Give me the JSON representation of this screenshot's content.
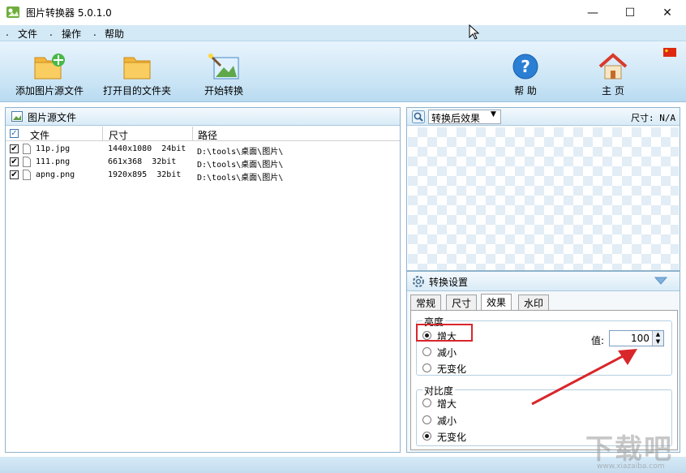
{
  "window": {
    "title": "图片转换器 5.0.1.0"
  },
  "menu": {
    "items": [
      "文件",
      "操作",
      "帮助"
    ]
  },
  "toolbar": {
    "add_source": "添加图片源文件",
    "open_dest": "打开目的文件夹",
    "start": "开始转换",
    "help": "帮 助",
    "home": "主 页"
  },
  "source_panel": {
    "title": "图片源文件",
    "columns": [
      "文件",
      "尺寸",
      "路径"
    ],
    "rows": [
      {
        "checked": true,
        "name": "11p.jpg",
        "size": "1440x1080  24bit",
        "path": "D:\\tools\\桌面\\图片\\"
      },
      {
        "checked": true,
        "name": "111.png",
        "size": "661x368  32bit",
        "path": "D:\\tools\\桌面\\图片\\"
      },
      {
        "checked": true,
        "name": "apng.png",
        "size": "1920x895  32bit",
        "path": "D:\\tools\\桌面\\图片\\"
      }
    ]
  },
  "preview": {
    "mode": "转换后效果",
    "size_label": "尺寸: N/A"
  },
  "settings": {
    "title": "转换设置",
    "tabs": [
      "常规",
      "尺寸",
      "效果",
      "水印"
    ],
    "active_tab": "效果",
    "brightness": {
      "label": "亮度",
      "options": [
        "增大",
        "减小",
        "无变化"
      ],
      "selected": "增大",
      "value_label": "值:",
      "value": "100"
    },
    "contrast": {
      "label": "对比度",
      "options": [
        "增大",
        "减小",
        "无变化"
      ],
      "selected": "无变化"
    }
  },
  "watermark": {
    "text": "下载吧",
    "url": "www.xiazaiba.com"
  }
}
